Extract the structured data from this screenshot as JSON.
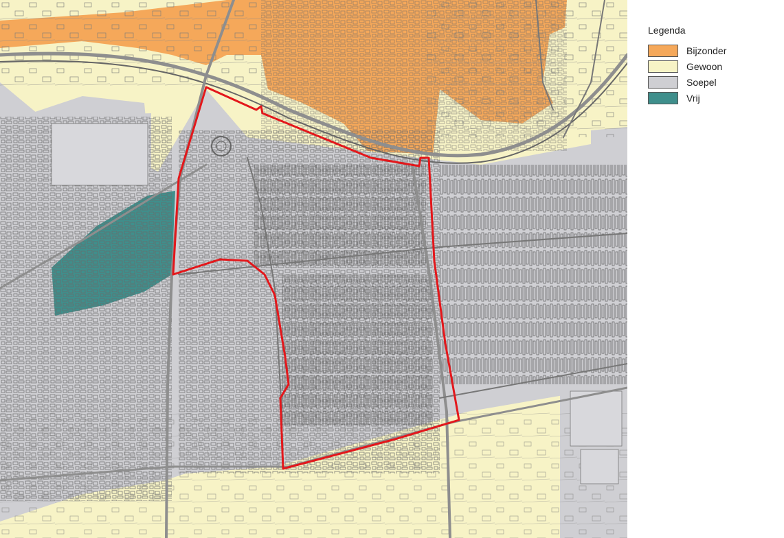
{
  "legend": {
    "title": "Legenda",
    "items": [
      {
        "key": "bijzonder",
        "label": "Bijzonder",
        "color": "#f5a85a"
      },
      {
        "key": "gewoon",
        "label": "Gewoon",
        "color": "#f7f3c6"
      },
      {
        "key": "soepel",
        "label": "Soepel",
        "color": "#cfcfd3"
      },
      {
        "key": "vrij",
        "label": "Vrij",
        "color": "#3f8f8c"
      }
    ]
  },
  "map": {
    "outline_color": "#e3171b",
    "street_line_color": "#555555",
    "road_color": "#9a9a9a"
  }
}
